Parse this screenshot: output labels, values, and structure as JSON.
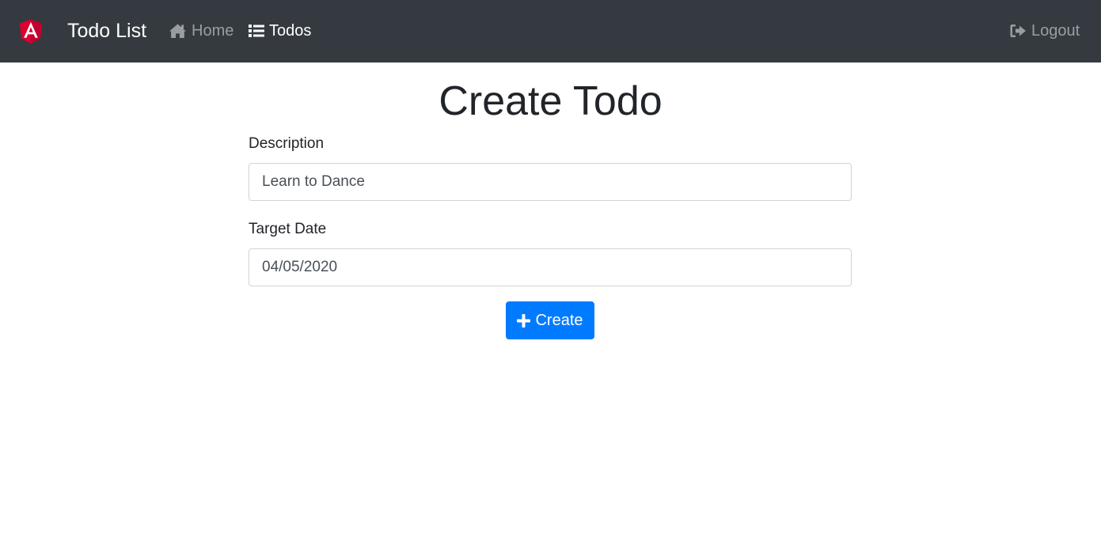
{
  "navbar": {
    "brand": "Todo List",
    "logo_icon": "angular-logo-icon",
    "links": [
      {
        "label": "Home",
        "icon": "home-icon",
        "active": false
      },
      {
        "label": "Todos",
        "icon": "list-icon",
        "active": true
      }
    ],
    "logout": {
      "label": "Logout",
      "icon": "sign-out-icon"
    }
  },
  "page": {
    "title": "Create Todo"
  },
  "form": {
    "description_label": "Description",
    "description_value": "Learn to Dance",
    "target_date_label": "Target Date",
    "target_date_value": "04/05/2020",
    "create_label": "Create",
    "create_icon": "plus-icon"
  },
  "colors": {
    "navbar_bg": "#343a40",
    "brand_red": "#dd0031",
    "primary": "#007bff"
  }
}
